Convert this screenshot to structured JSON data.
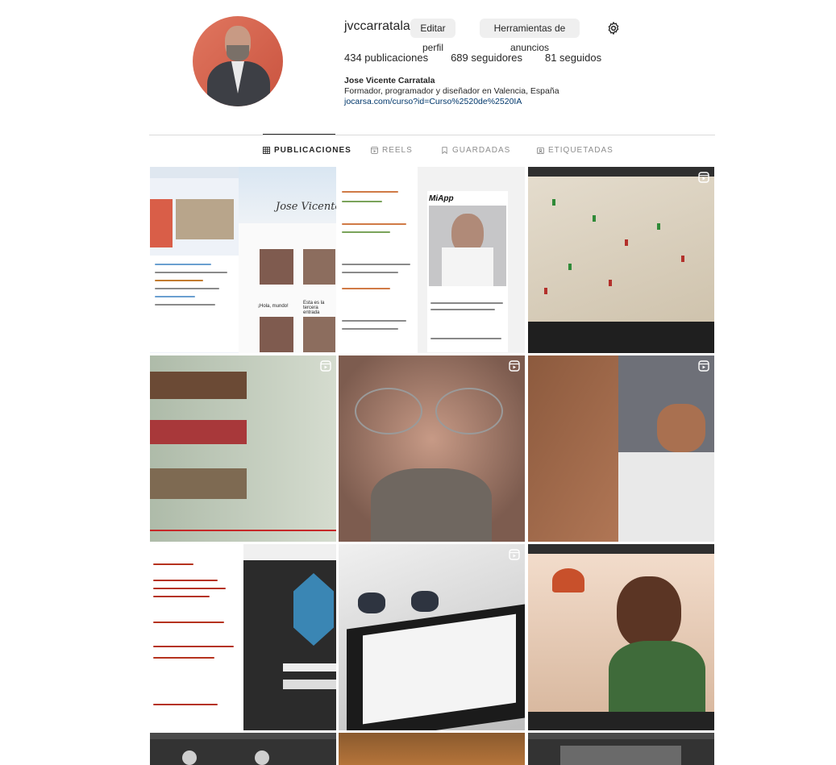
{
  "profile": {
    "username": "jvccarratala",
    "edit_button": "Editar perfil",
    "ads_button": "Herramientas de anuncios",
    "stats": {
      "posts": "434 publicaciones",
      "followers": "689 seguidores",
      "following": "81 seguidos"
    },
    "full_name": "Jose Vicente Carratala",
    "bio": "Formador, programador y diseñador en Valencia, España",
    "link": "jocarsa.com/curso?id=Curso%2520de%2520IA"
  },
  "tabs": [
    {
      "label": "PUBLICACIONES",
      "icon": "grid-icon",
      "active": true
    },
    {
      "label": "REELS",
      "icon": "reels-icon",
      "active": false
    },
    {
      "label": "GUARDADAS",
      "icon": "bookmark-icon",
      "active": false
    },
    {
      "label": "ETIQUETADAS",
      "icon": "tagged-icon",
      "active": false
    }
  ],
  "thumbnails": {
    "t1_title": "Jose Vicente C",
    "t1_caption": "¡Hola, mundo!",
    "t1_caption2": "Esta es la tercera entrada",
    "t2_app": "MiApp"
  }
}
